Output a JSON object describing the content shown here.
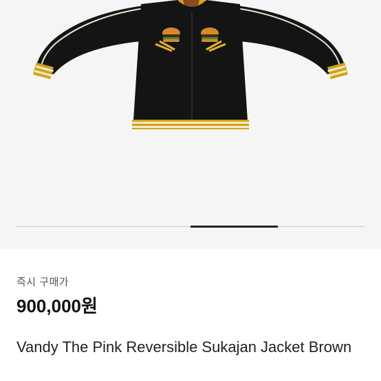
{
  "product": {
    "image_icon": "jacket-product-photo",
    "price_label": "즉시 구매가",
    "price": "900,000원",
    "title": "Vandy The Pink Reversible Sukajan Jacket Brown"
  },
  "carousel": {
    "active_slide": 3,
    "total_slides": 4
  },
  "colors": {
    "gallery_bg": "#f5f5f5",
    "jacket_body": "#141414",
    "trim_yellow": "#d6a20f",
    "trim_cream": "#f3ecd6",
    "indicator": "#222222"
  }
}
